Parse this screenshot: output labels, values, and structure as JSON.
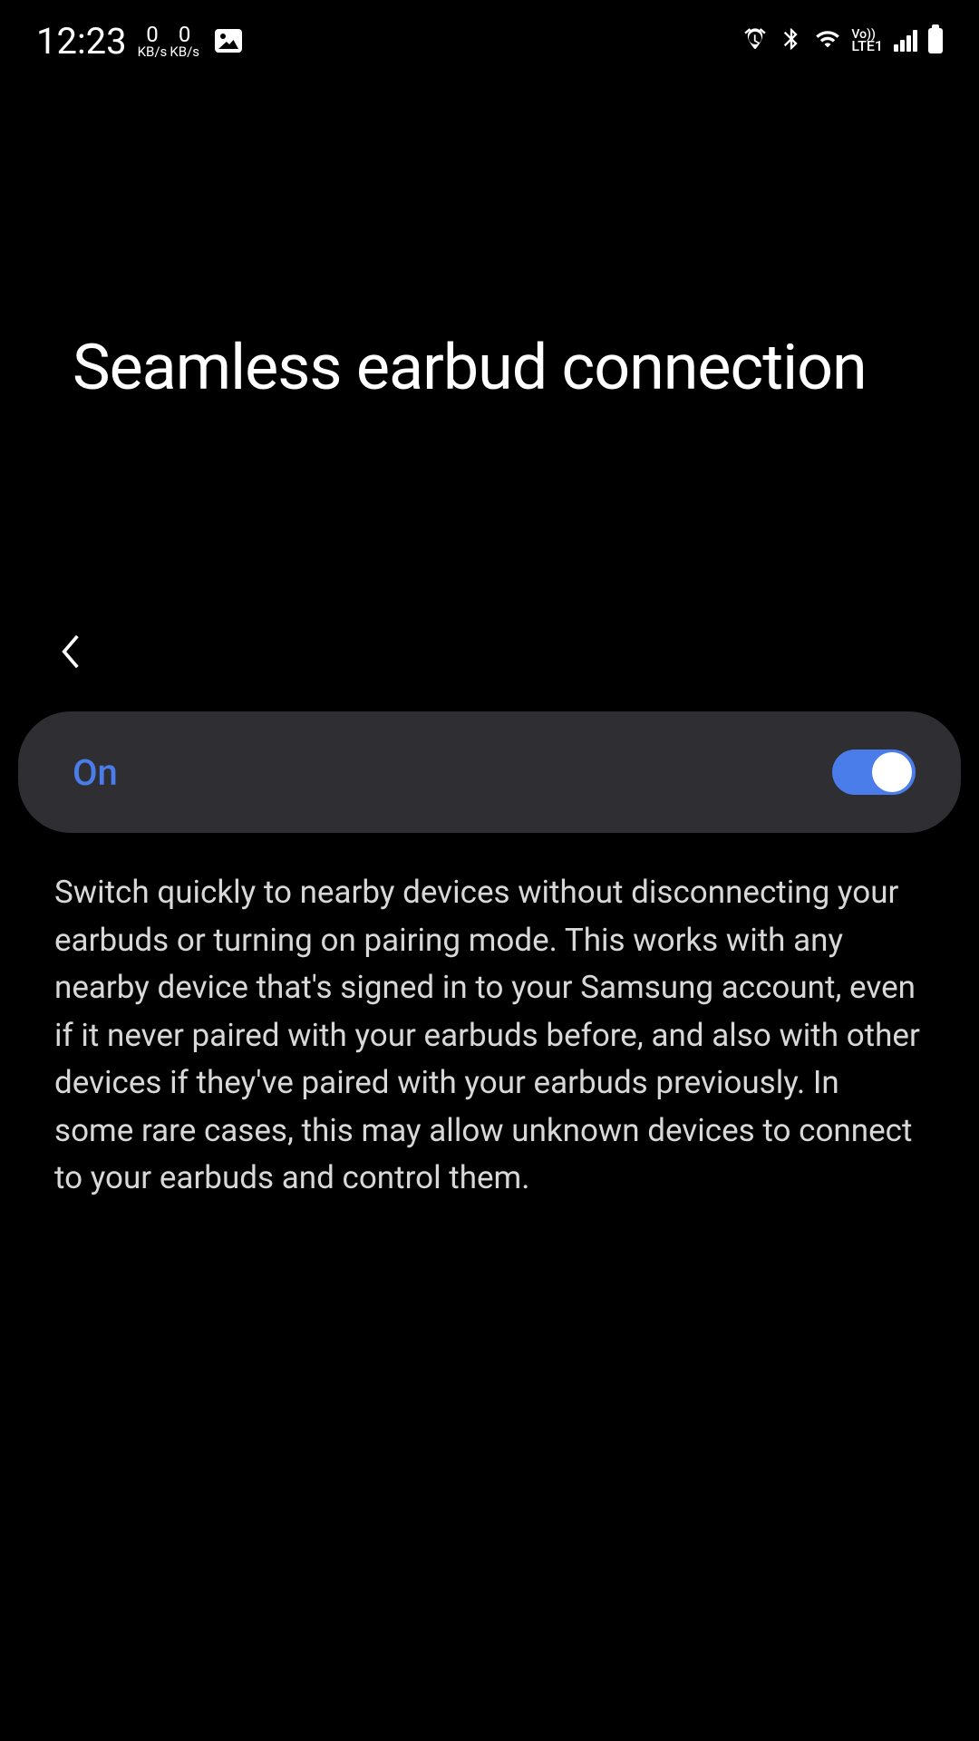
{
  "status_bar": {
    "time": "12:23",
    "speed1_value": "0",
    "speed1_unit": "KB/s",
    "speed2_value": "0",
    "speed2_unit": "KB/s",
    "volte_label": "Vo))",
    "lte_label": "LTE1"
  },
  "page": {
    "title": "Seamless earbud connection"
  },
  "toggle": {
    "label": "On",
    "state": true,
    "accent_color": "#4b7dea"
  },
  "description": {
    "text": "Switch quickly to nearby devices without disconnecting your earbuds or turning on pairing mode. This works with any nearby device that's signed in to your Samsung account, even if it never paired with your earbuds before, and also with other devices if they've paired with your earbuds previously. In some rare cases, this may allow unknown devices to connect to your earbuds and control them."
  }
}
